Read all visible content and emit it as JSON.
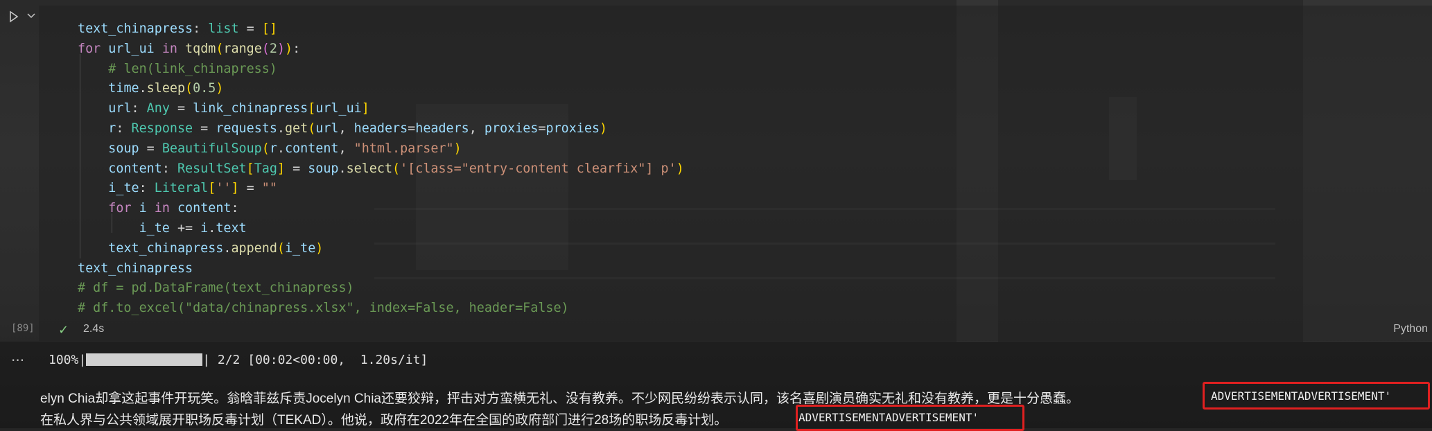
{
  "cell": {
    "execution_count": "[89]",
    "status_icon": "check-icon",
    "duration": "2.4s",
    "language": "Python"
  },
  "output": {
    "more_label": "···",
    "progress_percent": "100%",
    "progress_value": 1.0,
    "progress_stats": " 2/2 [00:02<00:00,  1.20s/it]",
    "line1_text": "elyn Chia却拿这起事件开玩笑。翁晗菲兹斥责Jocelyn Chia还要狡辩，抨击对方蛮横无礼、没有教养。不少网民纷纷表示认同，该名喜剧演员确实无礼和没有教养，更是十分愚蠢。",
    "line1_adv": "ADVERTISEMENTADVERTISEMENT'",
    "line2_text": "在私人界与公共领域展开职场反毒计划（TEKAD）。他说，政府在2022年在全国的政府部门进行28场的职场反毒计划。",
    "line2_adv": "ADVERTISEMENTADVERTISEMENT'"
  },
  "colors": {
    "keyword": "#c586c0",
    "variable": "#9cdcfe",
    "function": "#dcdcaa",
    "class": "#4ec9b0",
    "number": "#b5cea8",
    "string": "#ce9178",
    "comment": "#6a9955",
    "highlight_box": "#e02020"
  },
  "code_lines": [
    "text_chinapress: list = []",
    "for url_ui in tqdm(range(2)):",
    "    # len(link_chinapress)",
    "    time.sleep(0.5)",
    "    url: Any = link_chinapress[url_ui]",
    "    r: Response = requests.get(url, headers=headers, proxies=proxies)",
    "    soup = BeautifulSoup(r.content, \"html.parser\")",
    "    content: ResultSet[Tag] = soup.select('[class=\"entry-content clearfix\"] p')",
    "    i_te: Literal[''] = \"\"",
    "    for i in content:",
    "        i_te += i.text",
    "    text_chinapress.append(i_te)",
    "text_chinapress",
    "# df = pd.DataFrame(text_chinapress)",
    "# df.to_excel(\"data/chinapress.xlsx\", index=False, header=False)"
  ]
}
